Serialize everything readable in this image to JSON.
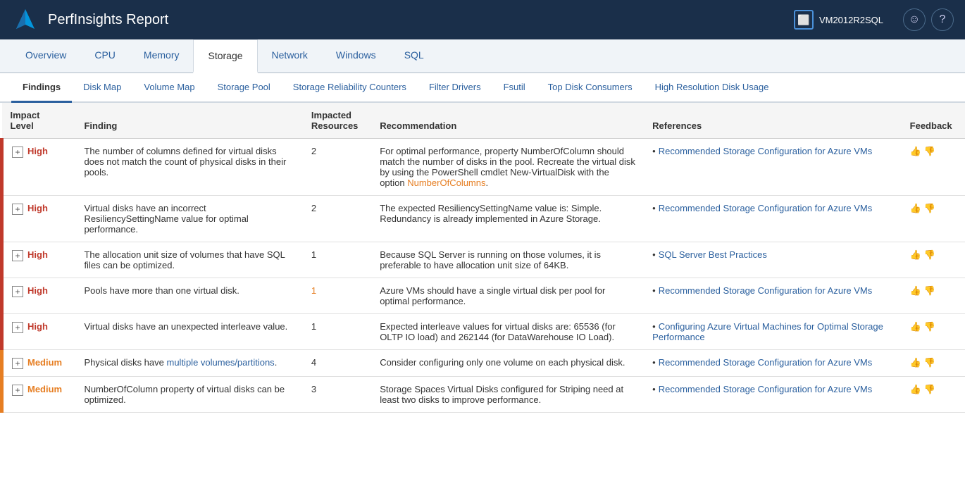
{
  "header": {
    "title": "PerfInsights Report",
    "vm_name": "VM2012R2SQL",
    "smile_icon": "☺",
    "help_icon": "?"
  },
  "main_tabs": [
    {
      "label": "Overview",
      "active": false
    },
    {
      "label": "CPU",
      "active": false
    },
    {
      "label": "Memory",
      "active": false
    },
    {
      "label": "Storage",
      "active": true
    },
    {
      "label": "Network",
      "active": false
    },
    {
      "label": "Windows",
      "active": false
    },
    {
      "label": "SQL",
      "active": false
    }
  ],
  "sub_tabs": [
    {
      "label": "Findings",
      "active": true
    },
    {
      "label": "Disk Map",
      "active": false
    },
    {
      "label": "Volume Map",
      "active": false
    },
    {
      "label": "Storage Pool",
      "active": false
    },
    {
      "label": "Storage Reliability Counters",
      "active": false
    },
    {
      "label": "Filter Drivers",
      "active": false
    },
    {
      "label": "Fsutil",
      "active": false
    },
    {
      "label": "Top Disk Consumers",
      "active": false
    },
    {
      "label": "High Resolution Disk Usage",
      "active": false
    }
  ],
  "table": {
    "columns": [
      {
        "label": "Impact\nLevel",
        "key": "impact"
      },
      {
        "label": "Finding",
        "key": "finding"
      },
      {
        "label": "Impacted\nResources",
        "key": "impacted"
      },
      {
        "label": "Recommendation",
        "key": "recommendation"
      },
      {
        "label": "References",
        "key": "references"
      },
      {
        "label": "Feedback",
        "key": "feedback"
      }
    ],
    "rows": [
      {
        "impact": "High",
        "impact_level": "high",
        "finding": "The number of columns defined for virtual disks does not match the count of physical disks in their pools.",
        "impacted": "2",
        "impacted_orange": false,
        "recommendation": "For optimal performance, property NumberOfColumn should match the number of disks in the pool. Recreate the virtual disk by using the PowerShell cmdlet New-VirtualDisk with the option NumberOfColumns.",
        "recommendation_highlight": "NumberOfColumns",
        "references": [
          {
            "text": "Recommended Storage Configuration for Azure VMs",
            "href": "#"
          }
        ]
      },
      {
        "impact": "High",
        "impact_level": "high",
        "finding": "Virtual disks have an incorrect ResiliencySettingName value for optimal performance.",
        "impacted": "2",
        "impacted_orange": false,
        "recommendation": "The expected ResiliencySettingName value is: Simple. Redundancy is already implemented in Azure Storage.",
        "recommendation_highlight": "",
        "references": [
          {
            "text": "Recommended Storage Configuration for Azure VMs",
            "href": "#"
          }
        ]
      },
      {
        "impact": "High",
        "impact_level": "high",
        "finding": "The allocation unit size of volumes that have SQL files can be optimized.",
        "impacted": "1",
        "impacted_orange": false,
        "recommendation": "Because SQL Server is running on those volumes, it is preferable to have allocation unit size of 64KB.",
        "recommendation_highlight": "",
        "references": [
          {
            "text": "SQL Server Best Practices",
            "href": "#"
          }
        ]
      },
      {
        "impact": "High",
        "impact_level": "high",
        "finding": "Pools have more than one virtual disk.",
        "impacted": "1",
        "impacted_orange": true,
        "recommendation": "Azure VMs should have a single virtual disk per pool for optimal performance.",
        "recommendation_highlight": "",
        "references": [
          {
            "text": "Recommended Storage Configuration for Azure VMs",
            "href": "#"
          }
        ]
      },
      {
        "impact": "High",
        "impact_level": "high",
        "finding": "Virtual disks have an unexpected interleave value.",
        "impacted": "1",
        "impacted_orange": false,
        "recommendation": "Expected interleave values for virtual disks are: 65536 (for OLTP IO load) and 262144 (for DataWarehouse IO Load).",
        "recommendation_highlight": "",
        "references": [
          {
            "text": "Configuring Azure Virtual Machines for Optimal Storage Performance",
            "href": "#"
          }
        ]
      },
      {
        "impact": "Medium",
        "impact_level": "medium",
        "finding": "Physical disks have multiple volumes/partitions.",
        "impacted": "4",
        "impacted_orange": false,
        "recommendation": "Consider configuring only one volume on each physical disk.",
        "recommendation_highlight": "",
        "references": [
          {
            "text": "Recommended Storage Configuration for Azure VMs",
            "href": "#"
          }
        ]
      },
      {
        "impact": "Medium",
        "impact_level": "medium",
        "finding": "NumberOfColumn property of virtual disks can be optimized.",
        "impacted": "3",
        "impacted_orange": false,
        "recommendation": "Storage Spaces Virtual Disks configured for Striping need at least two disks to improve performance.",
        "recommendation_highlight": "",
        "references": [
          {
            "text": "Recommended Storage Configuration for Azure VMs",
            "href": "#"
          }
        ]
      }
    ]
  }
}
